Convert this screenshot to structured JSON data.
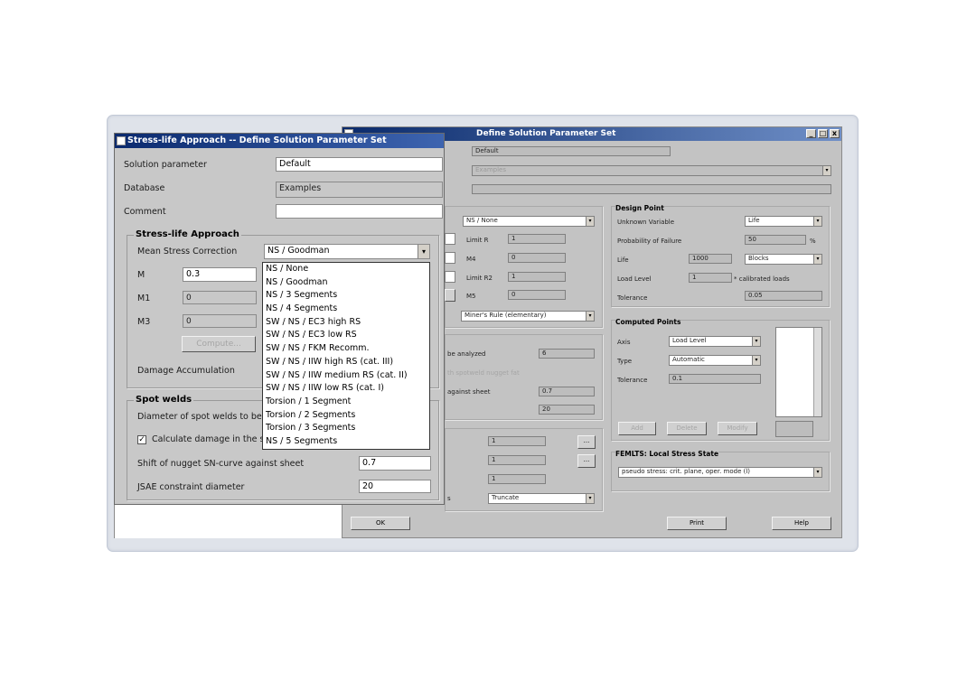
{
  "main_window": {
    "title": "Stress-life Approach -- Define Solution Parameter Set",
    "title_visible_fragment": "Define Solution Parameter Set",
    "solution_value": "Default",
    "database_value": "Examples",
    "mid": {
      "mean_stress_value": "NS / None",
      "limit_r_label": "Limit R",
      "limit_r_value": "1",
      "m4_label": "M4",
      "m4_value": "0",
      "limit_r2_label": "Limit R2",
      "limit_r2_value": "1",
      "m5_label": "M5",
      "m5_value": "0",
      "damage_value": "Miner's Rule (elementary)",
      "analyzed_text": "be analyzed",
      "analyzed_value": "6",
      "faded_text": "th spotweld nugget fat",
      "against_text": "against sheet",
      "against_value": "0.7",
      "constraint_value": "20",
      "sa_value1": "1",
      "sa_value2": "1",
      "sa_value3": "1",
      "ellipsis": "...",
      "truncate_suffix": "s",
      "truncate_value": "Truncate"
    },
    "design_point": {
      "heading": "Design Point",
      "unknown_label": "Unknown Variable",
      "unknown_value": "Life",
      "prob_label": "Probability of Failure",
      "prob_value": "50",
      "prob_unit": "%",
      "life_label": "Life",
      "life_value": "1000",
      "life_unit": "Blocks",
      "load_label": "Load Level",
      "load_value": "1",
      "load_note": "* calibrated loads",
      "tol_label": "Tolerance",
      "tol_value": "0.05"
    },
    "computed_points": {
      "heading": "Computed Points",
      "axis_label": "Axis",
      "axis_value": "Load Level",
      "type_label": "Type",
      "type_value": "Automatic",
      "tol_label": "Tolerance",
      "tol_value": "0.1",
      "add_label": "Add",
      "delete_label": "Delete",
      "modify_label": "Modify"
    },
    "femlts": {
      "heading": "FEMLTS: Local Stress State",
      "value": "pseudo stress: crit. plane, oper. mode (l)"
    },
    "ok_label": "OK",
    "print_label": "Print",
    "help_label": "Help"
  },
  "front_dialog": {
    "title": "Stress-life Approach -- Define Solution Parameter Set",
    "solution_label": "Solution parameter",
    "solution_value": "Default",
    "database_label": "Database",
    "database_value": "Examples",
    "comment_label": "Comment",
    "comment_value": "",
    "sla_heading": "Stress-life Approach",
    "mean_stress_label": "Mean Stress Correction",
    "mean_stress_value": "NS / Goodman",
    "m_label": "M",
    "m_value": "0.3",
    "m1_label": "M1",
    "m1_value": "0",
    "m3_label": "M3",
    "m3_value": "0",
    "compute_label": "Compute...",
    "damage_label": "Damage Accumulation",
    "spot_heading": "Spot welds",
    "spot_diameter_label": "Diameter of spot welds to be",
    "calc_damage_label": "Calculate damage in the s",
    "shift_label": "Shift of nugget SN-curve against sheet",
    "shift_value": "0.7",
    "jsae_label": "JSAE constraint diameter",
    "jsae_value": "20"
  },
  "dropdown_options": [
    "NS / None",
    "NS / Goodman",
    "NS / 3 Segments",
    "NS / 4 Segments",
    "SW / NS / EC3 high RS",
    "SW / NS / EC3 low RS",
    "SW / NS / FKM Recomm.",
    "SW / NS / IIW high RS (cat. III)",
    "SW / NS / IIW medium RS (cat. II)",
    "SW / NS / IIW low RS (cat. I)",
    "Torsion / 1 Segment",
    "Torsion / 2 Segments",
    "Torsion / 3 Segments",
    "NS / 5 Segments"
  ]
}
